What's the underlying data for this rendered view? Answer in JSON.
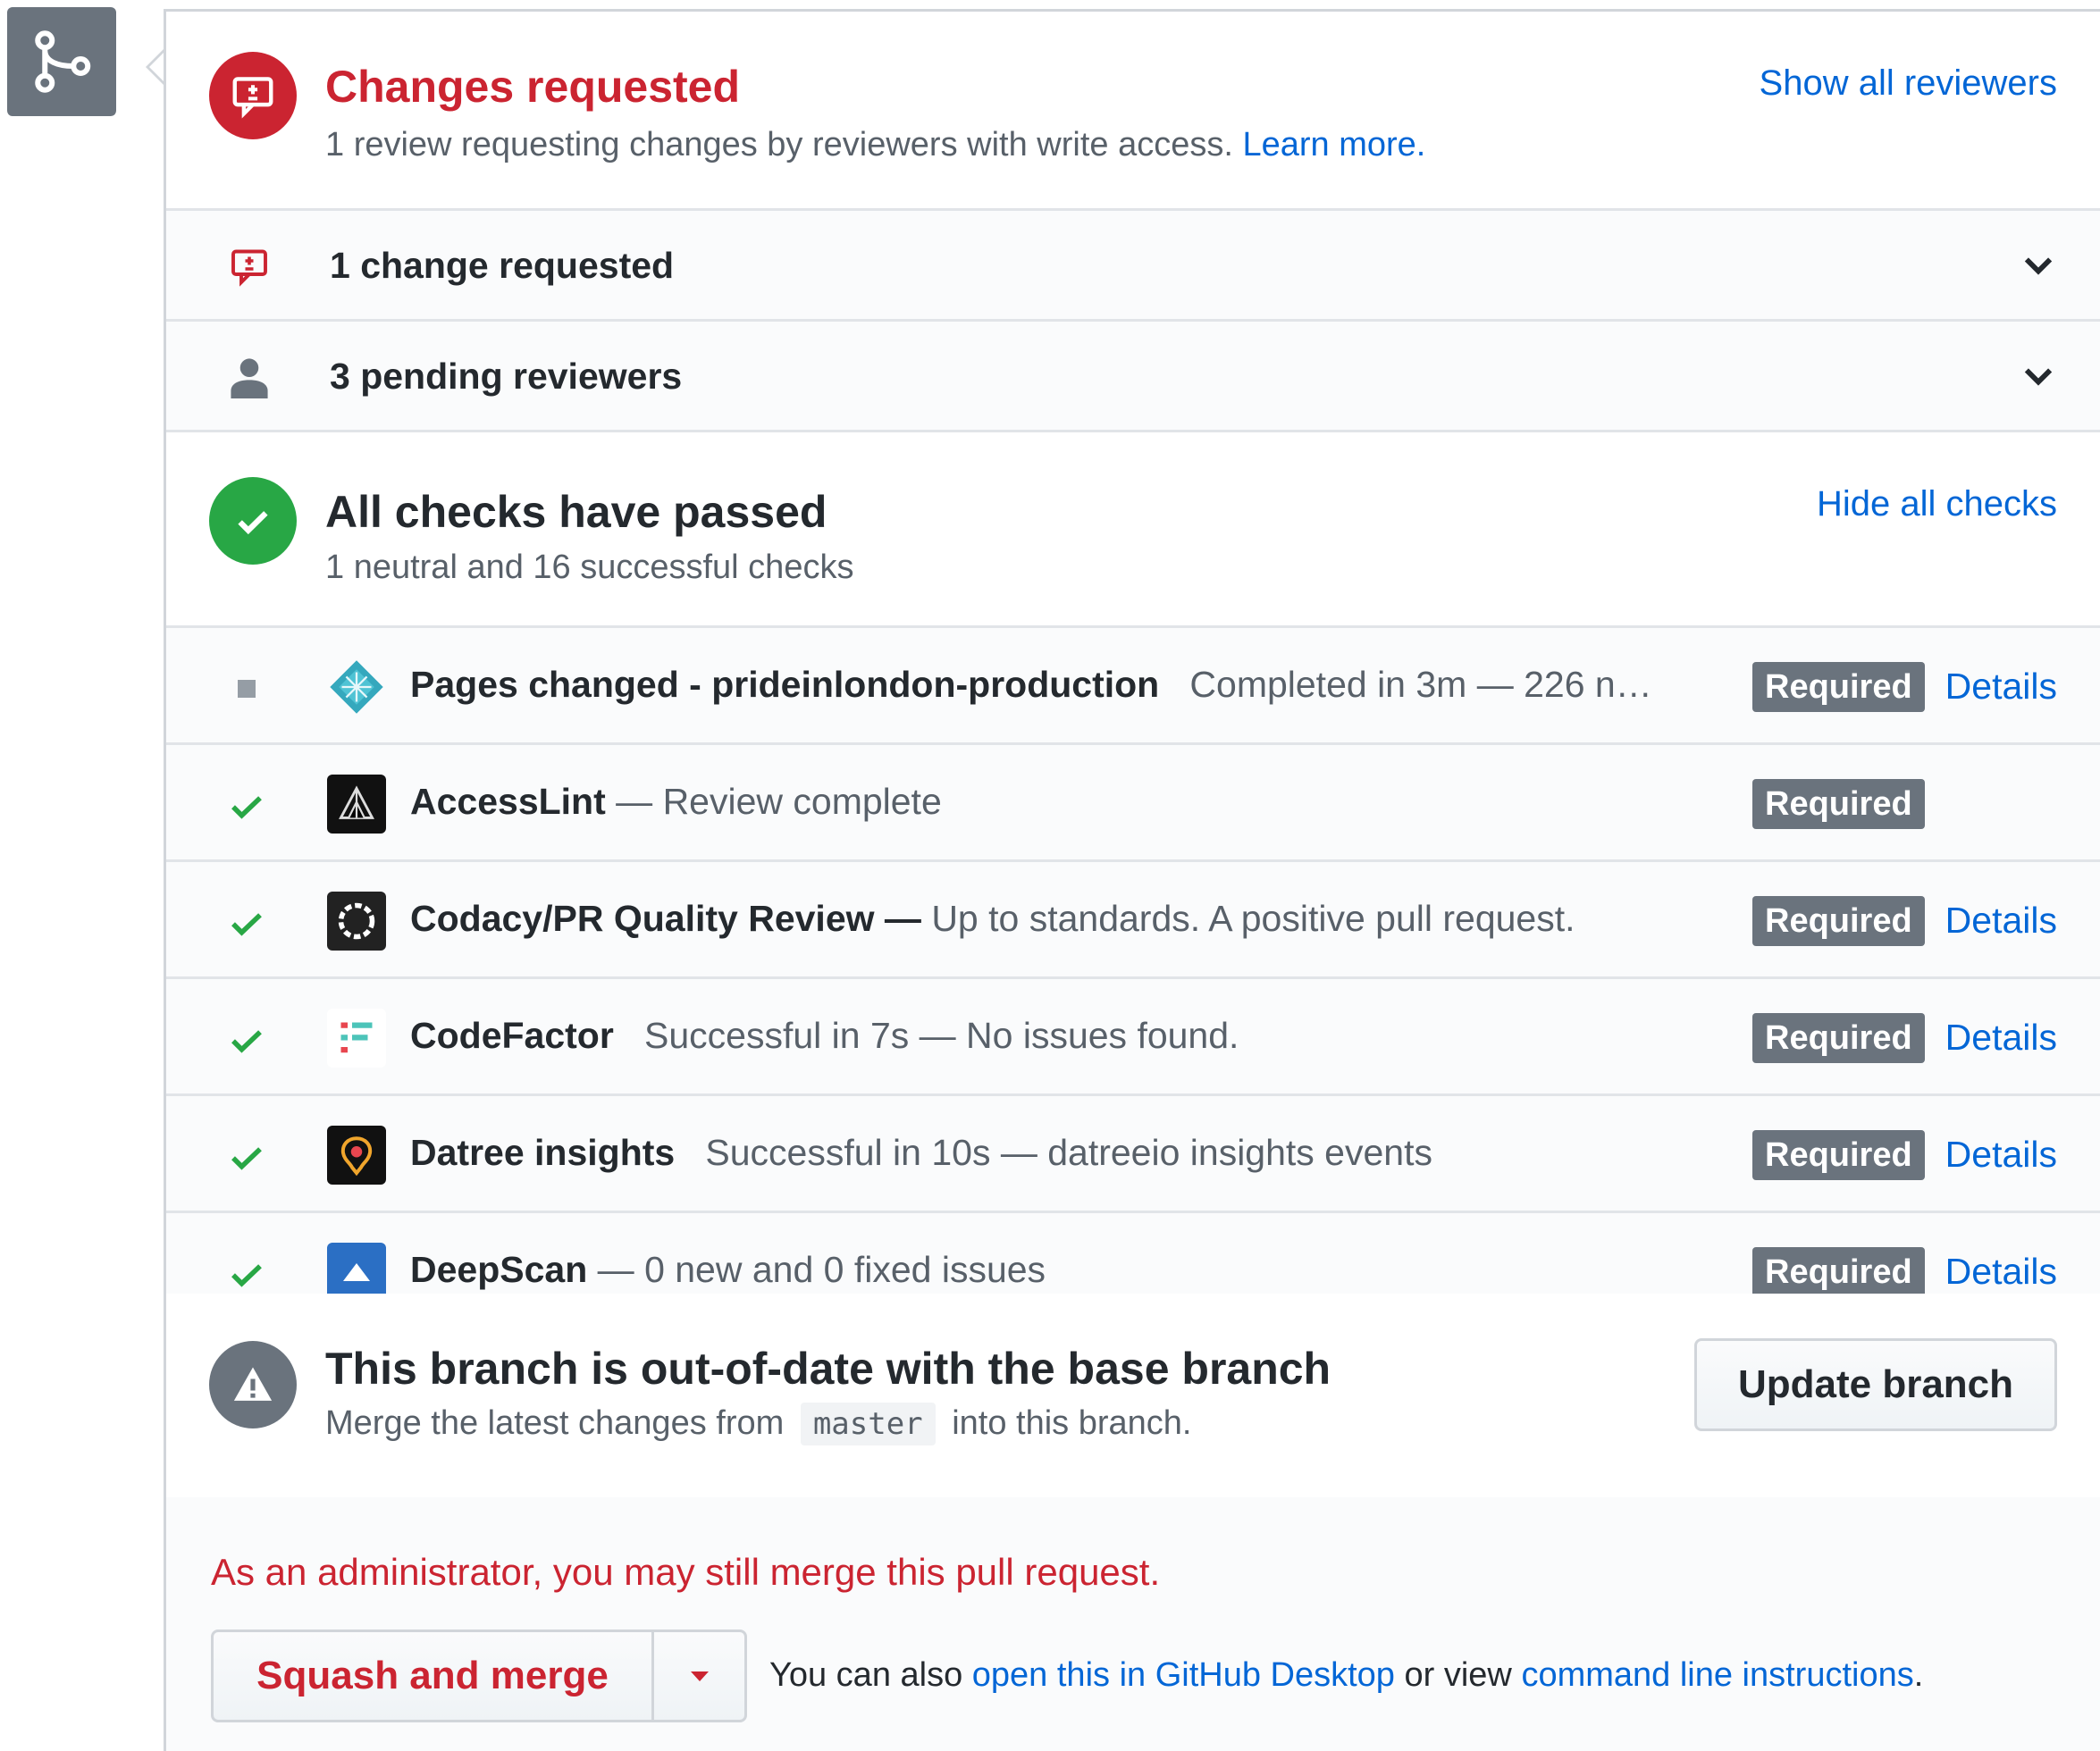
{
  "review": {
    "title": "Changes requested",
    "subtitle": "1 review requesting changes by reviewers with write access.",
    "learn_more": "Learn more.",
    "show_all": "Show all reviewers"
  },
  "changes_row": {
    "label": "1 change requested"
  },
  "pending_row": {
    "label": "3 pending reviewers"
  },
  "checks_summary": {
    "title": "All checks have passed",
    "subtitle": "1 neutral and 16 successful checks",
    "hide_all": "Hide all checks"
  },
  "checks": [
    {
      "status": "neutral",
      "name": "Pages changed - prideinlondon-production",
      "desc": "Completed in 3m — 226 n…",
      "required": "Required",
      "details": "Details",
      "logo": "netlify-logo"
    },
    {
      "status": "success",
      "name": "AccessLint",
      "desc": "— Review complete",
      "required": "Required",
      "details": "",
      "logo": "accesslint-logo"
    },
    {
      "status": "success",
      "name": "Codacy/PR Quality Review —",
      "desc": "Up to standards. A positive pull request.",
      "required": "Required",
      "details": "Details",
      "logo": "codacy-logo"
    },
    {
      "status": "success",
      "name": "CodeFactor",
      "desc": "Successful in 7s — No issues found.",
      "required": "Required",
      "details": "Details",
      "logo": "codefactor-logo"
    },
    {
      "status": "success",
      "name": "Datree insights",
      "desc": "Successful in 10s — datreeio insights events",
      "required": "Required",
      "details": "Details",
      "logo": "datree-logo"
    },
    {
      "status": "success",
      "name": "DeepScan",
      "desc": "— 0 new and 0 fixed issues",
      "required": "Required",
      "details": "Details",
      "logo": "deepscan-logo"
    }
  ],
  "out_of_date": {
    "title": "This branch is out-of-date with the base branch",
    "sub_before": "Merge the latest changes from",
    "branch": "master",
    "sub_after": "into this branch.",
    "button": "Update branch"
  },
  "merge": {
    "admin_note": "As an administrator, you may still merge this pull request.",
    "button": "Squash and merge",
    "hint_1": "You can also",
    "link_desktop": "open this in GitHub Desktop",
    "hint_2": "or view",
    "link_cli": "command line instructions",
    "hint_3": "."
  },
  "colors": {
    "danger": "#cb2431",
    "success": "#28a745",
    "link": "#0366d6",
    "badge": "#6a737d"
  }
}
